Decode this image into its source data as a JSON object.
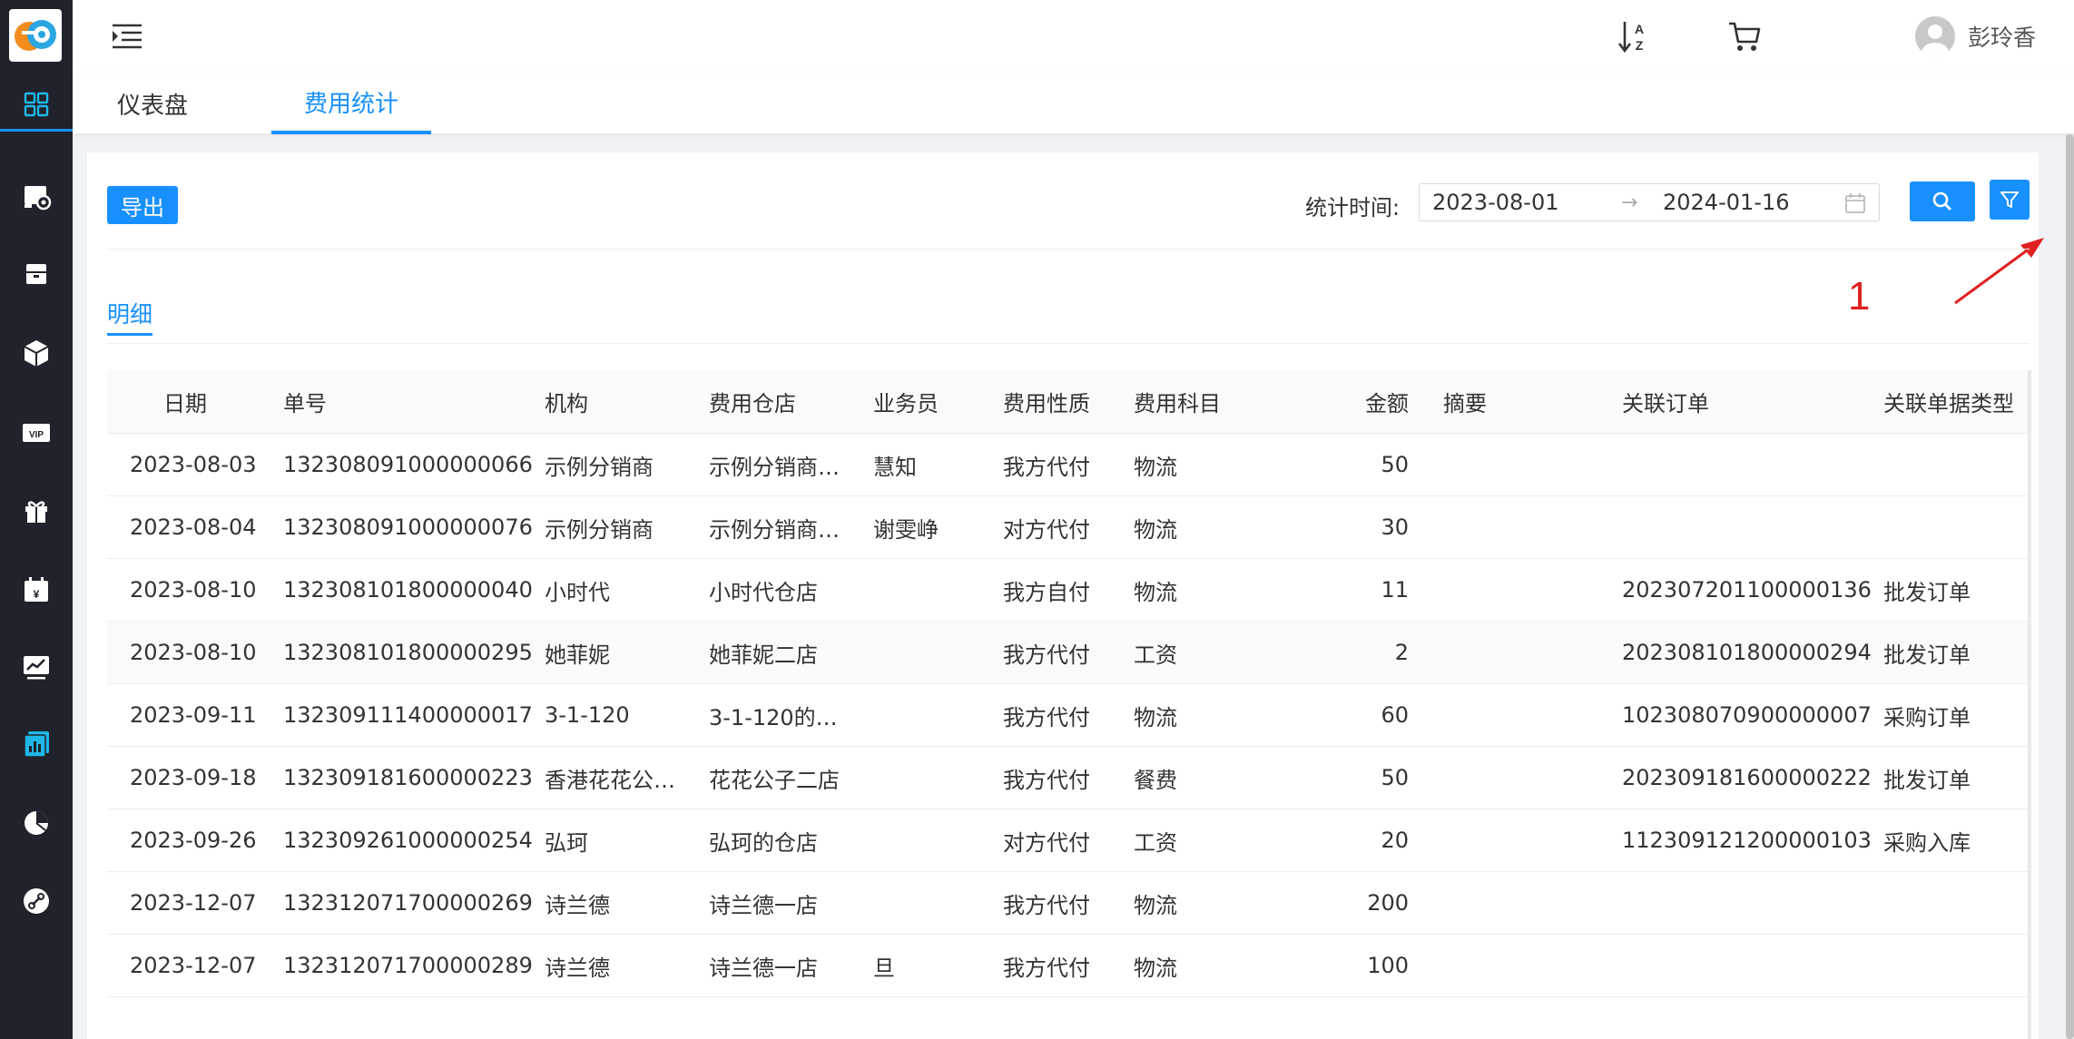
{
  "header": {
    "user_name": "彭玲香"
  },
  "tabs": [
    {
      "label": "仪表盘",
      "active": false
    },
    {
      "label": "费用统计",
      "active": true
    }
  ],
  "toolbar": {
    "export_label": "导出",
    "stat_time_label": "统计时间:",
    "date_start": "2023-08-01",
    "date_end": "2024-01-16",
    "range_separator": "→"
  },
  "annotation": {
    "number": "1",
    "color": "#e02020"
  },
  "sub_tab": {
    "label": "明细"
  },
  "table": {
    "columns": [
      "日期",
      "单号",
      "机构",
      "费用仓店",
      "业务员",
      "费用性质",
      "费用科目",
      "金额",
      "摘要",
      "关联订单",
      "关联单据类型"
    ],
    "rows": [
      [
        "2023-08-03",
        "132308091000000066",
        "示例分销商",
        "示例分销商…",
        "慧知",
        "我方代付",
        "物流",
        "50",
        "",
        "",
        ""
      ],
      [
        "2023-08-04",
        "132308091000000076",
        "示例分销商",
        "示例分销商…",
        "谢雯峥",
        "对方代付",
        "物流",
        "30",
        "",
        "",
        ""
      ],
      [
        "2023-08-10",
        "132308101800000040",
        "小时代",
        "小时代仓店",
        "",
        "我方自付",
        "物流",
        "11",
        "",
        "202307201100000136",
        "批发订单"
      ],
      [
        "2023-08-10",
        "132308101800000295",
        "她菲妮",
        "她菲妮二店",
        "",
        "我方代付",
        "工资",
        "2",
        "",
        "202308101800000294",
        "批发订单"
      ],
      [
        "2023-09-11",
        "132309111400000017",
        "3-1-120",
        "3-1-120的…",
        "",
        "我方代付",
        "物流",
        "60",
        "",
        "102308070900000007",
        "采购订单"
      ],
      [
        "2023-09-18",
        "132309181600000223",
        "香港花花公…",
        "花花公子二店",
        "",
        "我方代付",
        "餐费",
        "50",
        "",
        "202309181600000222",
        "批发订单"
      ],
      [
        "2023-09-26",
        "132309261000000254",
        "弘珂",
        "弘珂的仓店",
        "",
        "对方代付",
        "工资",
        "20",
        "",
        "112309121200000103",
        "采购入库"
      ],
      [
        "2023-12-07",
        "132312071700000269",
        "诗兰德",
        "诗兰德一店",
        "",
        "我方代付",
        "物流",
        "200",
        "",
        "",
        ""
      ],
      [
        "2023-12-07",
        "132312071700000289",
        "诗兰德",
        "诗兰德一店",
        "旦",
        "我方代付",
        "物流",
        "100",
        "",
        "",
        ""
      ]
    ]
  },
  "colors": {
    "primary": "#1890ff",
    "sidebar_bg": "#20232b",
    "annotation_red": "#e02020"
  },
  "sidebar_icons": [
    "dashboard-icon",
    "settings-monitor-icon",
    "archive-box-icon",
    "package-cube-icon",
    "vip-card-icon",
    "gift-icon",
    "calendar-yen-icon",
    "trend-chart-icon",
    "report-chart-icon",
    "pie-chart-icon",
    "link-icon"
  ]
}
